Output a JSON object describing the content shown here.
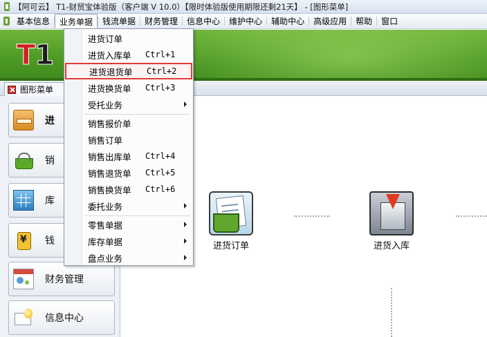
{
  "window": {
    "title": "【阿可云】 T1-财贸宝体验版（客户端 V 10.0）【限时体验版使用期限还剩21天】 - [图形菜单]"
  },
  "menubar": {
    "items": [
      "基本信息",
      "业务单据",
      "钱流单据",
      "财务管理",
      "信息中心",
      "维护中心",
      "辅助中心",
      "高级应用",
      "帮助",
      "窗口"
    ],
    "active_index": 1
  },
  "banner": {
    "logo_t": "T",
    "logo_one": "1"
  },
  "tab": {
    "label": "图形菜单"
  },
  "sidebar": {
    "items": [
      {
        "label": "进",
        "icon": "shopping-cart-icon",
        "selected": true
      },
      {
        "label": "销",
        "icon": "basket-icon",
        "selected": false
      },
      {
        "label": "库",
        "icon": "grid-icon",
        "selected": false
      },
      {
        "label": "钱",
        "icon": "coin-icon",
        "selected": false
      },
      {
        "label": "财务管理",
        "icon": "calendar-icon",
        "selected": false
      },
      {
        "label": "信息中心",
        "icon": "info-bulb-icon",
        "selected": false
      }
    ]
  },
  "main": {
    "nodes": [
      {
        "label": "进货订单",
        "icon": "purchase-order-icon"
      },
      {
        "label": "进货入库",
        "icon": "stock-in-icon"
      }
    ]
  },
  "dropdown": {
    "items": [
      {
        "label": "进货订单",
        "shortcut": "",
        "submenu": false
      },
      {
        "label": "进货入库单",
        "shortcut": "Ctrl+1",
        "submenu": false
      },
      {
        "label": "进货退货单",
        "shortcut": "Ctrl+2",
        "submenu": false,
        "highlighted": true
      },
      {
        "label": "进货换货单",
        "shortcut": "Ctrl+3",
        "submenu": false
      },
      {
        "label": "受托业务",
        "shortcut": "",
        "submenu": true
      },
      {
        "label": "销售报价单",
        "shortcut": "",
        "submenu": false
      },
      {
        "label": "销售订单",
        "shortcut": "",
        "submenu": false
      },
      {
        "label": "销售出库单",
        "shortcut": "Ctrl+4",
        "submenu": false
      },
      {
        "label": "销售退货单",
        "shortcut": "Ctrl+5",
        "submenu": false
      },
      {
        "label": "销售换货单",
        "shortcut": "Ctrl+6",
        "submenu": false
      },
      {
        "label": "委托业务",
        "shortcut": "",
        "submenu": true
      },
      {
        "label": "零售单据",
        "shortcut": "",
        "submenu": true
      },
      {
        "label": "库存单据",
        "shortcut": "",
        "submenu": true
      },
      {
        "label": "盘点业务",
        "shortcut": "",
        "submenu": true
      }
    ]
  },
  "colors": {
    "banner_green": "#4e9a26",
    "highlight_border": "#e03a3a"
  }
}
